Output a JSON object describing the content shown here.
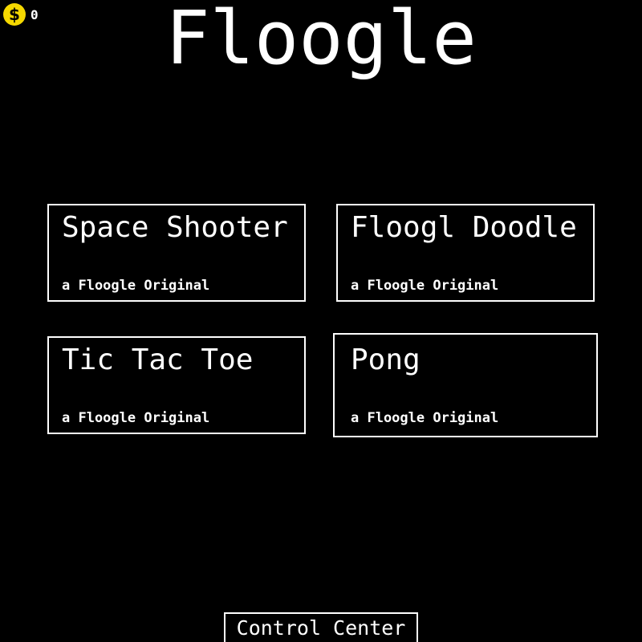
{
  "coins": {
    "icon": "dollar-coin-icon",
    "symbol": "$",
    "count": "0",
    "color": "#f5d800"
  },
  "app": {
    "title": "Floogle"
  },
  "games": [
    {
      "title": "Space Shooter",
      "subtitle": "a Floogle Original"
    },
    {
      "title": "Floogl Doodle",
      "subtitle": "a Floogle Original"
    },
    {
      "title": "Tic Tac Toe",
      "subtitle": "a Floogle Original"
    },
    {
      "title": "Pong",
      "subtitle": "a Floogle Original"
    }
  ],
  "footer": {
    "control_center_label": "Control Center"
  },
  "colors": {
    "background": "#000000",
    "foreground": "#ffffff"
  }
}
